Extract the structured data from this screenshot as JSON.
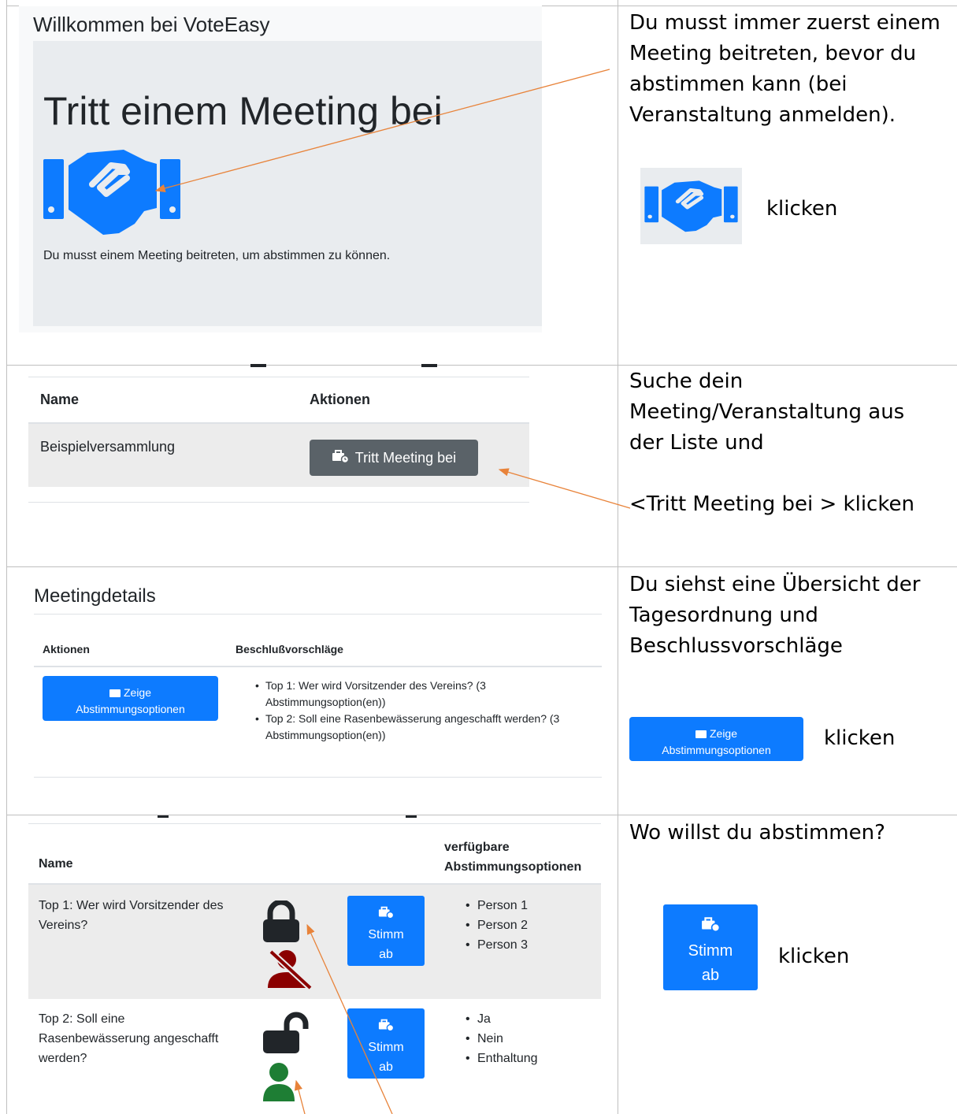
{
  "row1": {
    "welcome_title": "Willkommen bei VoteEasy",
    "jumbotron_heading": "Tritt einem Meeting bei",
    "jumbotron_lead": "Du musst einem Meeting beitreten, um abstimmen zu können.",
    "instruction_lines": [
      "Du musst immer zuerst einem",
      "Meeting beitreten, bevor du",
      "abstimmen kann (bei",
      "Veranstaltung anmelden)."
    ],
    "click_label": "klicken",
    "icon": "handshake-icon"
  },
  "row2": {
    "col_name": "Name",
    "col_actions": "Aktionen",
    "meeting_name": "Beispielversammlung",
    "join_button": "Tritt Meeting bei",
    "instruction_lines": [
      "Suche dein",
      "Meeting/Veranstaltung aus",
      "der Liste und"
    ],
    "instruction_click": "<Tritt Meeting bei > klicken"
  },
  "row3": {
    "title": "Meetingdetails",
    "col_actions": "Aktionen",
    "col_proposals": "Beschlußvorschläge",
    "show_options_line1": "Zeige",
    "show_options_line2": "Abstimmungsoptionen",
    "proposals": [
      [
        "Top 1: Wer wird Vorsitzender des Vereins? (3",
        "Abstimmungsoption(en))"
      ],
      [
        "Top 2: Soll eine Rasenbewässerung angeschafft werden? (3",
        "Abstimmungsoption(en))"
      ]
    ],
    "instruction_lines": [
      "Du siehst eine Übersicht der",
      "Tagesordnung und",
      "Beschlussvorschläge"
    ],
    "click_label": "klicken"
  },
  "row4": {
    "col_name": "Name",
    "col_options_line1": "verfügbare",
    "col_options_line2": "Abstimmungsoptionen",
    "items": [
      {
        "name_lines": [
          "Top 1: Wer wird Vorsitzender des",
          "Vereins?"
        ],
        "status": "locked",
        "options": [
          "Person 1",
          "Person 2",
          "Person 3"
        ]
      },
      {
        "name_lines": [
          "Top 2: Soll eine",
          "Rasenbewässerung angeschafft",
          "werden?"
        ],
        "status": "unlocked",
        "options": [
          "Ja",
          "Nein",
          "Enthaltung"
        ]
      }
    ],
    "vote_label_1": "Stimm",
    "vote_label_2": "ab",
    "instruction": "Wo willst du abstimmen?",
    "click_label": "klicken"
  },
  "colors": {
    "primary_blue": "#0d7bff",
    "secondary_gray": "#5a6268",
    "arrow_orange": "#e8833a",
    "locked_red": "#8b0000",
    "unlocked_green": "#1e7e34"
  }
}
